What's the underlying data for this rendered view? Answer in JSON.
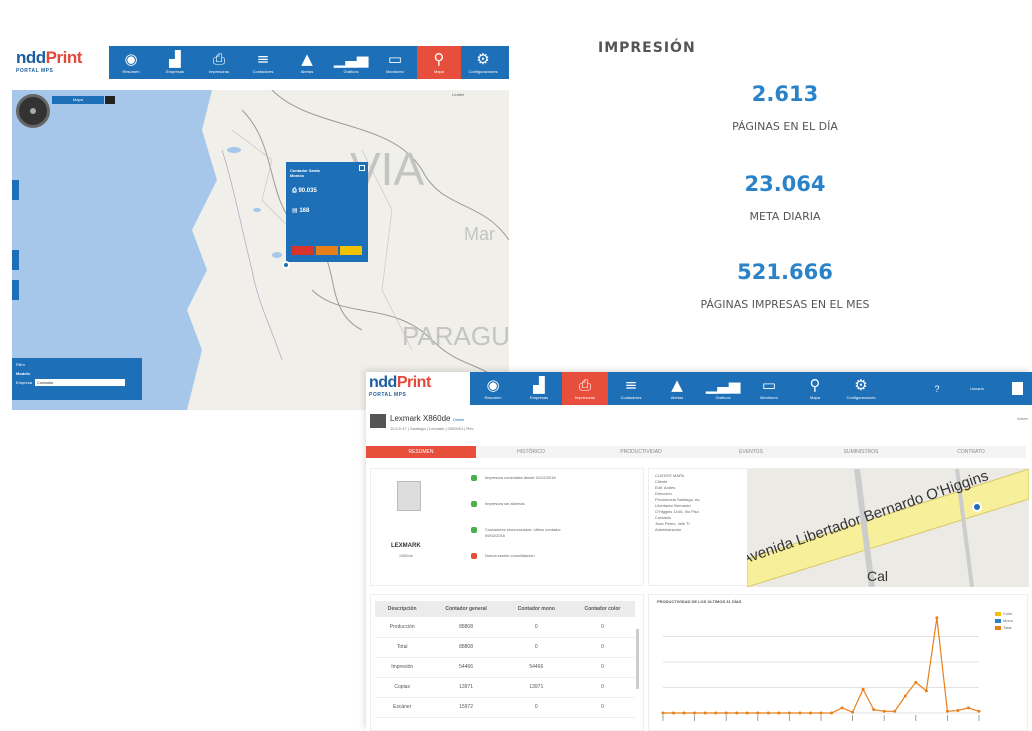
{
  "brand": {
    "logo_main": "ndd",
    "logo_accent": "Print",
    "subtitle": "PORTAL MPS"
  },
  "nav_top": [
    {
      "icon": "dashboard-icon",
      "glyph": "◉",
      "label": "Resumen"
    },
    {
      "icon": "factory-icon",
      "glyph": "▟",
      "label": "Empresas"
    },
    {
      "icon": "printer-icon",
      "glyph": "⎙",
      "label": "Impresoras"
    },
    {
      "icon": "list-icon",
      "glyph": "≡",
      "label": "Contadores"
    },
    {
      "icon": "warning-icon",
      "glyph": "▲",
      "label": "Alertas"
    },
    {
      "icon": "bar-chart-icon",
      "glyph": "▁▃▅",
      "label": "Gráficos"
    },
    {
      "icon": "monitor-icon",
      "glyph": "▭",
      "label": "Monitoreo"
    },
    {
      "icon": "map-pin-icon",
      "glyph": "⚲",
      "label": "Mapa"
    },
    {
      "icon": "settings-icon",
      "glyph": "⚙",
      "label": "Configuraciones"
    }
  ],
  "map": {
    "toggle_label": "Mapa",
    "credit": "Leaflet",
    "labels": {
      "country1": "VIA",
      "country2": "PARAGUAY",
      "city": "Mar"
    },
    "popup": {
      "title": "Contador Santa Monica",
      "stat1": "90.035",
      "stat2": "168",
      "status_colors": [
        "#d9342b",
        "#e8801a",
        "#f2c200"
      ]
    },
    "filter": {
      "title": "Filtro",
      "label": "Modelo",
      "field_label": "Empresa",
      "select_value": "Contador"
    }
  },
  "stats": {
    "heading": "IMPRESIÓN",
    "items": [
      {
        "value": "2.613",
        "label": "PÁGINAS EN EL DÍA"
      },
      {
        "value": "23.064",
        "label": "META DIARIA"
      },
      {
        "value": "521.666",
        "label": "PÁGINAS IMPRESAS EN EL MES"
      }
    ]
  },
  "detail": {
    "nav": [
      {
        "icon": "dashboard-icon",
        "glyph": "◉",
        "label": "Resumen"
      },
      {
        "icon": "factory-icon",
        "glyph": "▟",
        "label": "Empresas"
      },
      {
        "icon": "printer-icon",
        "glyph": "⎙",
        "label": "Impresoras",
        "active": true
      },
      {
        "icon": "list-icon",
        "glyph": "≡",
        "label": "Contadores"
      },
      {
        "icon": "warning-icon",
        "glyph": "▲",
        "label": "Alertas"
      },
      {
        "icon": "bar-chart-icon",
        "glyph": "▁▃▅",
        "label": "Gráficos"
      },
      {
        "icon": "monitor-icon",
        "glyph": "▭",
        "label": "Monitoreo"
      },
      {
        "icon": "map-pin-icon",
        "glyph": "⚲",
        "label": "Mapa"
      },
      {
        "icon": "settings-icon",
        "glyph": "⚙",
        "label": "Configuraciones"
      }
    ],
    "help": "?",
    "user": "Usuario",
    "printer_title": "Lexmark X860de",
    "printer_status": "Online",
    "meta": "10.0.0.47  |  Santiago  |  Lexmark  |  0000001  |  Rev",
    "back": "Volver",
    "tabs": [
      "RESUMEN",
      "HISTÓRICO",
      "PRODUCTIVIDAD",
      "EVENTOS",
      "SUMINISTROS",
      "CONTRATO"
    ],
    "brand_label": "LEXMARK",
    "model_label": "X860de",
    "alerts": [
      {
        "icon": "info-icon",
        "text": "Impresora conectada desde 01/02/2016",
        "color": "#4caf50"
      },
      {
        "icon": "warning-icon",
        "text": "Impresora sin alarmas",
        "color": "#4caf50"
      },
      {
        "icon": "counter-icon",
        "text": "Contadores sincronizados: último contador 09/02/2016",
        "color": "#4caf50"
      },
      {
        "icon": "flag-icon",
        "text": "Nueva sesión consolidación",
        "color": "#e84e3c"
      }
    ],
    "location_lines": [
      "CLIENTE MAPA",
      "Cliente",
      "Edif. Andes",
      "Dirección",
      "Providencia Santiago, Av.",
      "Libertador Bernardo",
      "O'Higgins 1440, 4to Piso",
      "Contacto",
      "Juan Pérez, Jefe TI",
      "Administración"
    ],
    "map_street": "Avenida Libertador Bernardo O'Higgins",
    "map_side": "Cal",
    "table": {
      "headers": [
        "Descripción",
        "Contador general",
        "Contador mono",
        "Contador color"
      ],
      "rows": [
        [
          "Producción",
          "88808",
          "0",
          "0"
        ],
        [
          "Total",
          "88808",
          "0",
          "0"
        ],
        [
          "Impresión",
          "54466",
          "54466",
          "0"
        ],
        [
          "Copias",
          "13971",
          "13971",
          "0"
        ],
        [
          "Escáner",
          "15972",
          "0",
          "0"
        ]
      ]
    },
    "chart_title": "PRODUCTIVIDAD DE LOS ÚLTIMOS 31 DÍAS",
    "legend": [
      {
        "name": "Color",
        "color": "#f2c200"
      },
      {
        "name": "Mono",
        "color": "#2a82c9"
      },
      {
        "name": "Total",
        "color": "#e8801a"
      }
    ]
  },
  "chart_data": {
    "type": "line",
    "title": "PRODUCTIVIDAD DE LOS ÚLTIMOS 31 DÍAS",
    "x": [
      1,
      2,
      3,
      4,
      5,
      6,
      7,
      8,
      9,
      10,
      11,
      12,
      13,
      14,
      15,
      16,
      17,
      18,
      19,
      20,
      21,
      22,
      23,
      24,
      25,
      26,
      27,
      28,
      29,
      30,
      31
    ],
    "series": [
      {
        "name": "Total",
        "values": [
          0,
          0,
          0,
          0,
          0,
          0,
          0,
          0,
          0,
          0,
          0,
          0,
          0,
          0,
          0,
          0,
          0,
          300,
          50,
          1400,
          200,
          100,
          100,
          1000,
          1800,
          1300,
          5600,
          100,
          150,
          300,
          100
        ]
      }
    ],
    "ylim": [
      0,
      6000
    ]
  }
}
